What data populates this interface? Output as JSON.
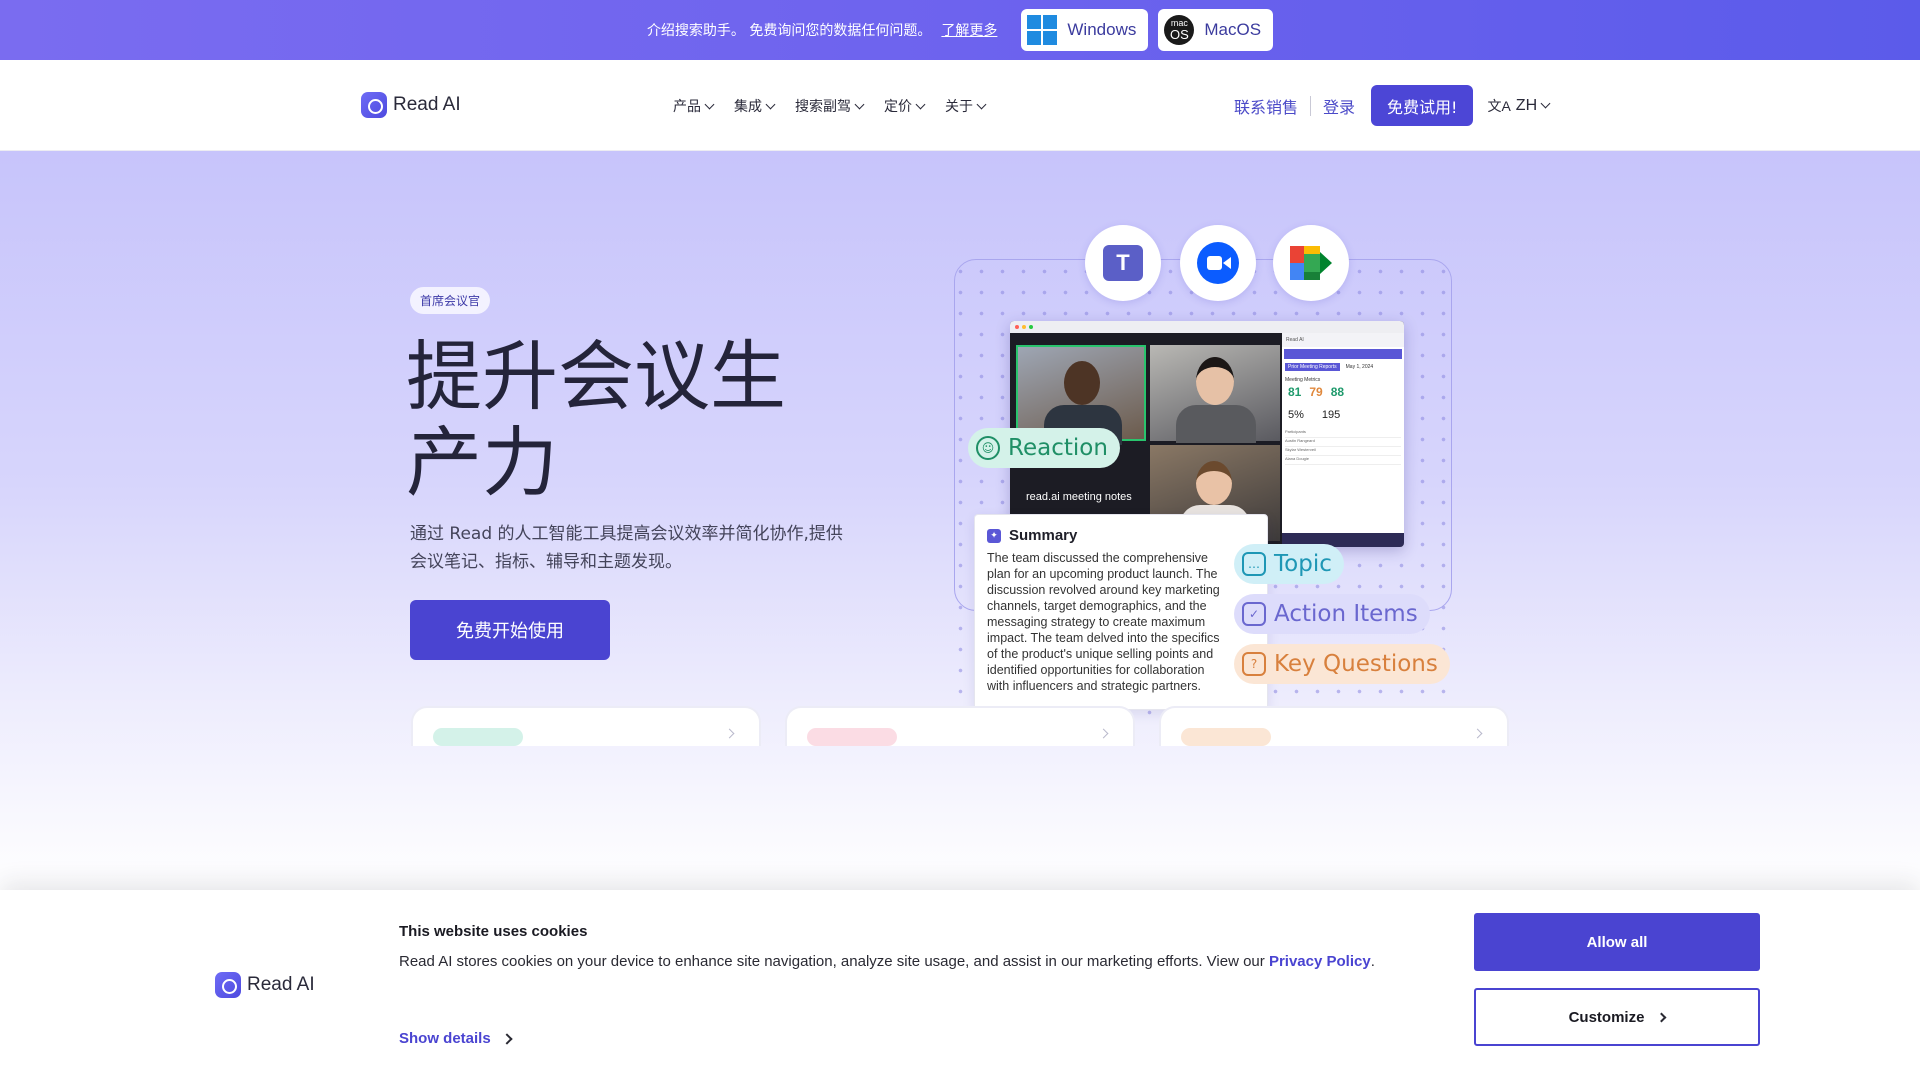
{
  "promo": {
    "text": "介绍搜索助手。 免费询问您的数据任何问题。",
    "link": "了解更多",
    "windows_label": "Windows",
    "macos_label": "MacOS",
    "mac_logo_small": "mac",
    "mac_logo_big": "OS"
  },
  "nav": {
    "brand": "Read AI",
    "menu": [
      "产品",
      "集成",
      "搜索副驾",
      "定价",
      "关于"
    ],
    "contact_sales": "联系销售",
    "login": "登录",
    "free_trial": "免费试用!",
    "lang": "ZH",
    "lang_icon": "文A"
  },
  "hero": {
    "badge": "首席会议官",
    "headline": "提升会议生产力",
    "subtext": "通过 Read 的人工智能工具提高会议效率并简化协作,提供会议笔记、指标、辅导和主题发现。",
    "cta": "免费开始使用"
  },
  "illustration": {
    "teams_letter": "T",
    "notes_label": "read.ai meeting notes",
    "panel_header": "Read AI",
    "panel_tabs": [
      "Prior Meeting Reports",
      "May 1, 2024"
    ],
    "panel_title": "Meeting Metrics",
    "metrics": [
      {
        "value": "81",
        "color": "#1f9a6c"
      },
      {
        "value": "79",
        "color": "#e0883c"
      },
      {
        "value": "88",
        "color": "#1f9a6c"
      }
    ],
    "metrics2": [
      "5%",
      "195"
    ],
    "participants_title": "Participants",
    "participants": [
      "Austin Rangeard",
      "Skylar Westerveil",
      "Alana Dougie"
    ],
    "reaction": "Reaction",
    "topic": "Topic",
    "action_items": "Action Items",
    "key_questions": "Key Questions",
    "summary_title": "Summary",
    "summary_lines": [
      "The team discussed the comprehensive",
      "plan for an upcoming product launch. The",
      "discussion revolved around key marketing",
      "channels, target demographics, and the",
      "messaging strategy to create maximum",
      "impact. The team delved into the specifics",
      "of the product's unique selling points and",
      "identified opportunities for collaboration",
      "with influencers and strategic partners."
    ]
  },
  "cards": [
    {
      "tag_color": "#d4f2e9"
    },
    {
      "tag_color": "#fbdce4"
    },
    {
      "tag_color": "#fbe6d5"
    }
  ],
  "cookie": {
    "brand": "Read AI",
    "title": "This website uses cookies",
    "body": "Read AI stores cookies on your device to enhance site navigation, analyze site usage, and assist in our marketing efforts. View our ",
    "policy_link": "Privacy Policy",
    "period": ".",
    "show_details": "Show details",
    "allow_all": "Allow all",
    "customize": "Customize"
  }
}
